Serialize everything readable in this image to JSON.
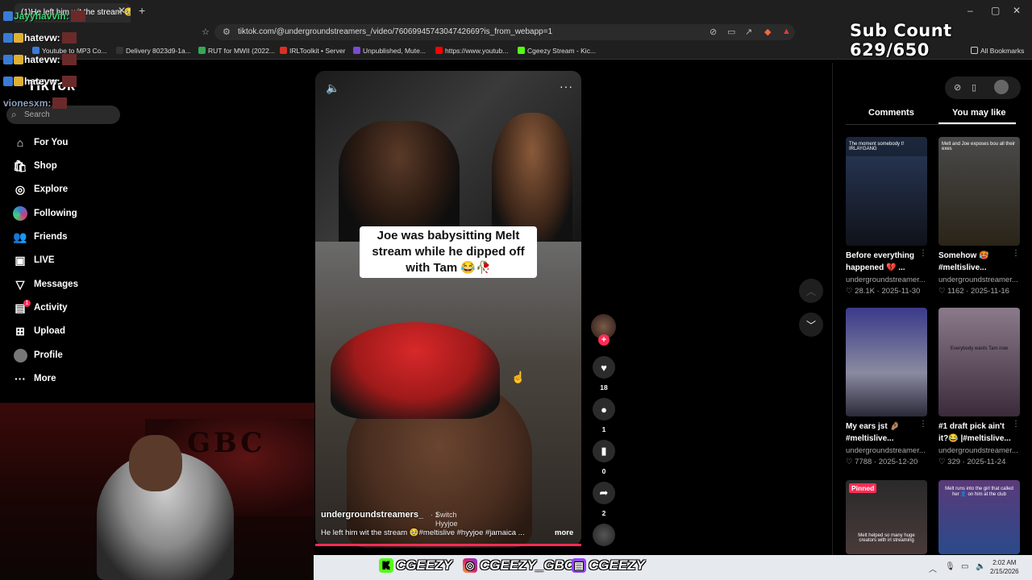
{
  "browser": {
    "tab_title": "(1)He left him wit the stream 🥹",
    "url": "tiktok.com/@undergroundstreamers_/video/7606994574304742669?is_from_webapp=1",
    "bookmarks": [
      "Youtube to MP3 Co...",
      "Delivery 8023d9-1a...",
      "RUT for MWII (2022...",
      "IRLToolkit • Server",
      "Unpublished, Mute...",
      "https://www.youtub...",
      "Cgeezy Stream - Kic..."
    ],
    "all_bookmarks": "All Bookmarks"
  },
  "overlay": {
    "sub_count": "Sub Count 629/650",
    "chat": [
      {
        "user": "Jayyhavvin:",
        "color": "#3cd070"
      },
      {
        "user": "hatevw:",
        "color": "#ffffff"
      },
      {
        "user": "hatevw:",
        "color": "#ffffff"
      },
      {
        "user": "hatevw:",
        "color": "#ffffff"
      },
      {
        "user": "vionesxm:",
        "color": "#8ca0c0"
      }
    ]
  },
  "sidebar": {
    "logo": "TikTok",
    "search_placeholder": "Search",
    "items": [
      {
        "label": "For You",
        "icon": "home-icon"
      },
      {
        "label": "Shop",
        "icon": "shop-icon"
      },
      {
        "label": "Explore",
        "icon": "compass-icon"
      },
      {
        "label": "Following",
        "icon": "following-icon"
      },
      {
        "label": "Friends",
        "icon": "friends-icon"
      },
      {
        "label": "LIVE",
        "icon": "live-icon"
      },
      {
        "label": "Messages",
        "icon": "messages-icon"
      },
      {
        "label": "Activity",
        "icon": "activity-icon"
      },
      {
        "label": "Upload",
        "icon": "upload-icon"
      },
      {
        "label": "Profile",
        "icon": "profile-icon"
      },
      {
        "label": "More",
        "icon": "more-icon"
      }
    ],
    "activity_badge": "1"
  },
  "video": {
    "caption": "Joe was babysitting Melt stream while he dipped off with Tam 😂🥀",
    "author": "undergroundstreamers_",
    "author_suffix": "· 1",
    "overlay_text": "Switch\nHyyjoe",
    "description": "He left him wit the stream 🥹#meltislive #hyyjoe #jamaica ...",
    "more": "more",
    "likes": "18",
    "comments": "1",
    "saves": "0",
    "shares": "2"
  },
  "right_panel": {
    "tabs": [
      "Comments",
      "You may like"
    ],
    "active_tab": "You may like",
    "cards": [
      {
        "title1": "Before everything",
        "title2": "happened 💔 ...",
        "author": "undergroundstreamer...",
        "likes": "28.1K",
        "date": "2025-11-30",
        "thumb": "#2a3a5a",
        "thumb_text": "The moment somebody t! IRLAYGANG"
      },
      {
        "title1": "Somehow 🥵",
        "title2": "#meltislive...",
        "author": "undergroundstreamer...",
        "likes": "1162",
        "date": "2025-11-16",
        "thumb": "#4a4a4a",
        "thumb_text": "Melt and Joe exposes bou all their exes"
      },
      {
        "title1": "My ears jst 🤌🏽",
        "title2": "#meltislive...",
        "author": "undergroundstreamer...",
        "likes": "7788",
        "date": "2025-12-20",
        "thumb": "#3a3a8a",
        "thumb_text": ""
      },
      {
        "title1": "#1 draft pick ain't",
        "title2": "it?😂 |#meltislive...",
        "author": "undergroundstreamer...",
        "likes": "329",
        "date": "2025-11-24",
        "thumb": "#6a5a6a",
        "thumb_text": "Everybody wants Tam now"
      },
      {
        "title1": "",
        "title2": "",
        "author": "",
        "likes": "",
        "date": "",
        "thumb": "#2a2a2a",
        "thumb_text": "Melt helped so many huge creators with irl streaming"
      },
      {
        "title1": "",
        "title2": "",
        "author": "",
        "likes": "",
        "date": "",
        "thumb": "#5a3a7a",
        "thumb_text": "Melt runs into the girl that called her 👤 on him at the club"
      }
    ],
    "pinned": "Pinned"
  },
  "social_bar": {
    "handles": [
      "CGEEZY",
      "CGEEZY_GBC",
      "CGEEZY"
    ]
  },
  "taskbar": {
    "time": "2:02 AM",
    "date": "2/15/2026"
  }
}
